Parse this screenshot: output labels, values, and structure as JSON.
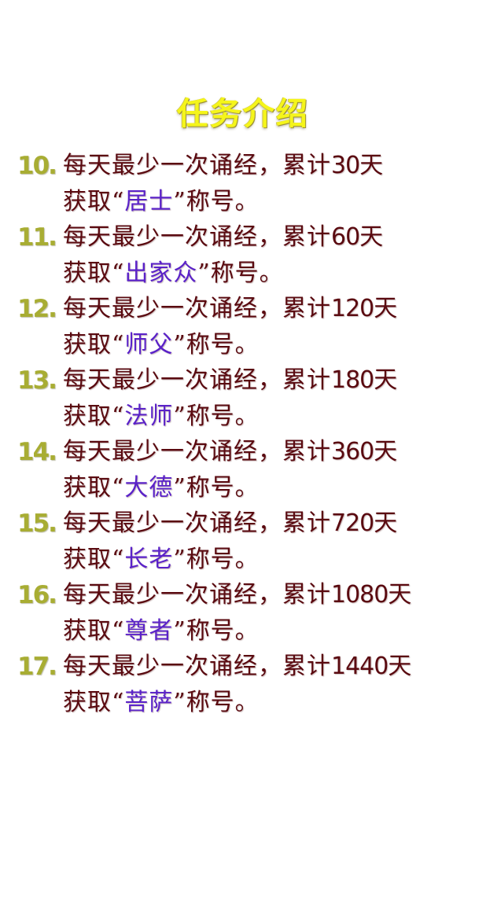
{
  "title": "任务介绍",
  "task_text_prefix": "每天最少一次诵经，累计",
  "day_unit": "天",
  "obtain_prefix": "获取",
  "open_quote": "“",
  "close_quote": "”",
  "title_suffix": "称号。",
  "tasks": [
    {
      "number": "10.",
      "days": "30",
      "rank": "居士"
    },
    {
      "number": "11.",
      "days": "60",
      "rank": "出家众"
    },
    {
      "number": "12.",
      "days": "120",
      "rank": "师父"
    },
    {
      "number": "13.",
      "days": "180",
      "rank": "法师"
    },
    {
      "number": "14.",
      "days": "360",
      "rank": "大德"
    },
    {
      "number": "15.",
      "days": "720",
      "rank": "长老"
    },
    {
      "number": "16.",
      "days": "1080",
      "rank": "尊者"
    },
    {
      "number": "17.",
      "days": "1440",
      "rank": "菩萨"
    }
  ]
}
